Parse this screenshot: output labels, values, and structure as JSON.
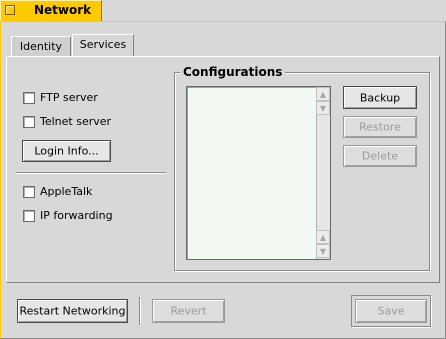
{
  "window": {
    "title": "Network"
  },
  "tabs": [
    {
      "label": "Identity"
    },
    {
      "label": "Services"
    }
  ],
  "services": {
    "ftp_label": "FTP server",
    "telnet_label": "Telnet server",
    "login_info_label": "Login Info...",
    "appletalk_label": "AppleTalk",
    "ip_forwarding_label": "IP forwarding"
  },
  "configurations": {
    "title": "Configurations",
    "backup_label": "Backup",
    "restore_label": "Restore",
    "delete_label": "Delete"
  },
  "footer": {
    "restart_label": "Restart Networking",
    "revert_label": "Revert",
    "save_label": "Save"
  },
  "icons": {
    "scroll_up": "▲",
    "scroll_down": "▼"
  },
  "colors": {
    "title_tab": "#ffcb00",
    "list_bg": "#f2f8f2"
  }
}
